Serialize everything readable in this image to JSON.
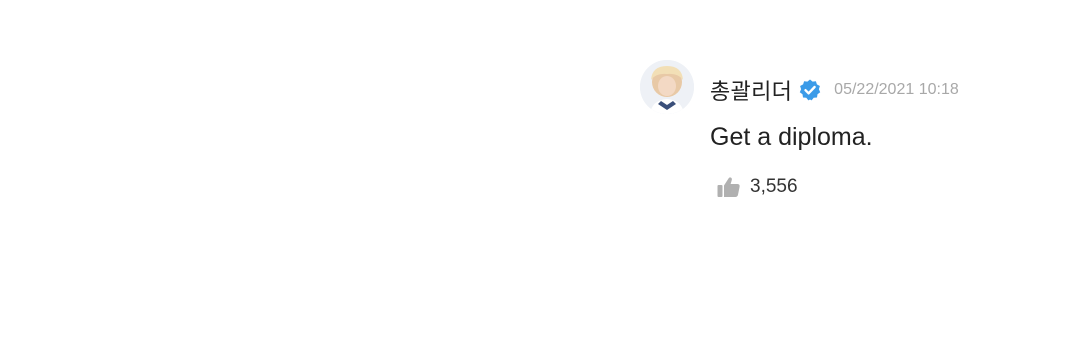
{
  "comment": {
    "author": "총괄리더",
    "timestamp": "05/22/2021 10:18",
    "text": "Get a diploma.",
    "likes": "3,556",
    "verified": true,
    "icons": {
      "verified": "verified-badge-icon",
      "like": "thumbs-up-icon"
    },
    "colors": {
      "verified_badge": "#3b9be8",
      "timestamp": "#a8a8a8",
      "like_icon": "#b0b0b0"
    }
  }
}
